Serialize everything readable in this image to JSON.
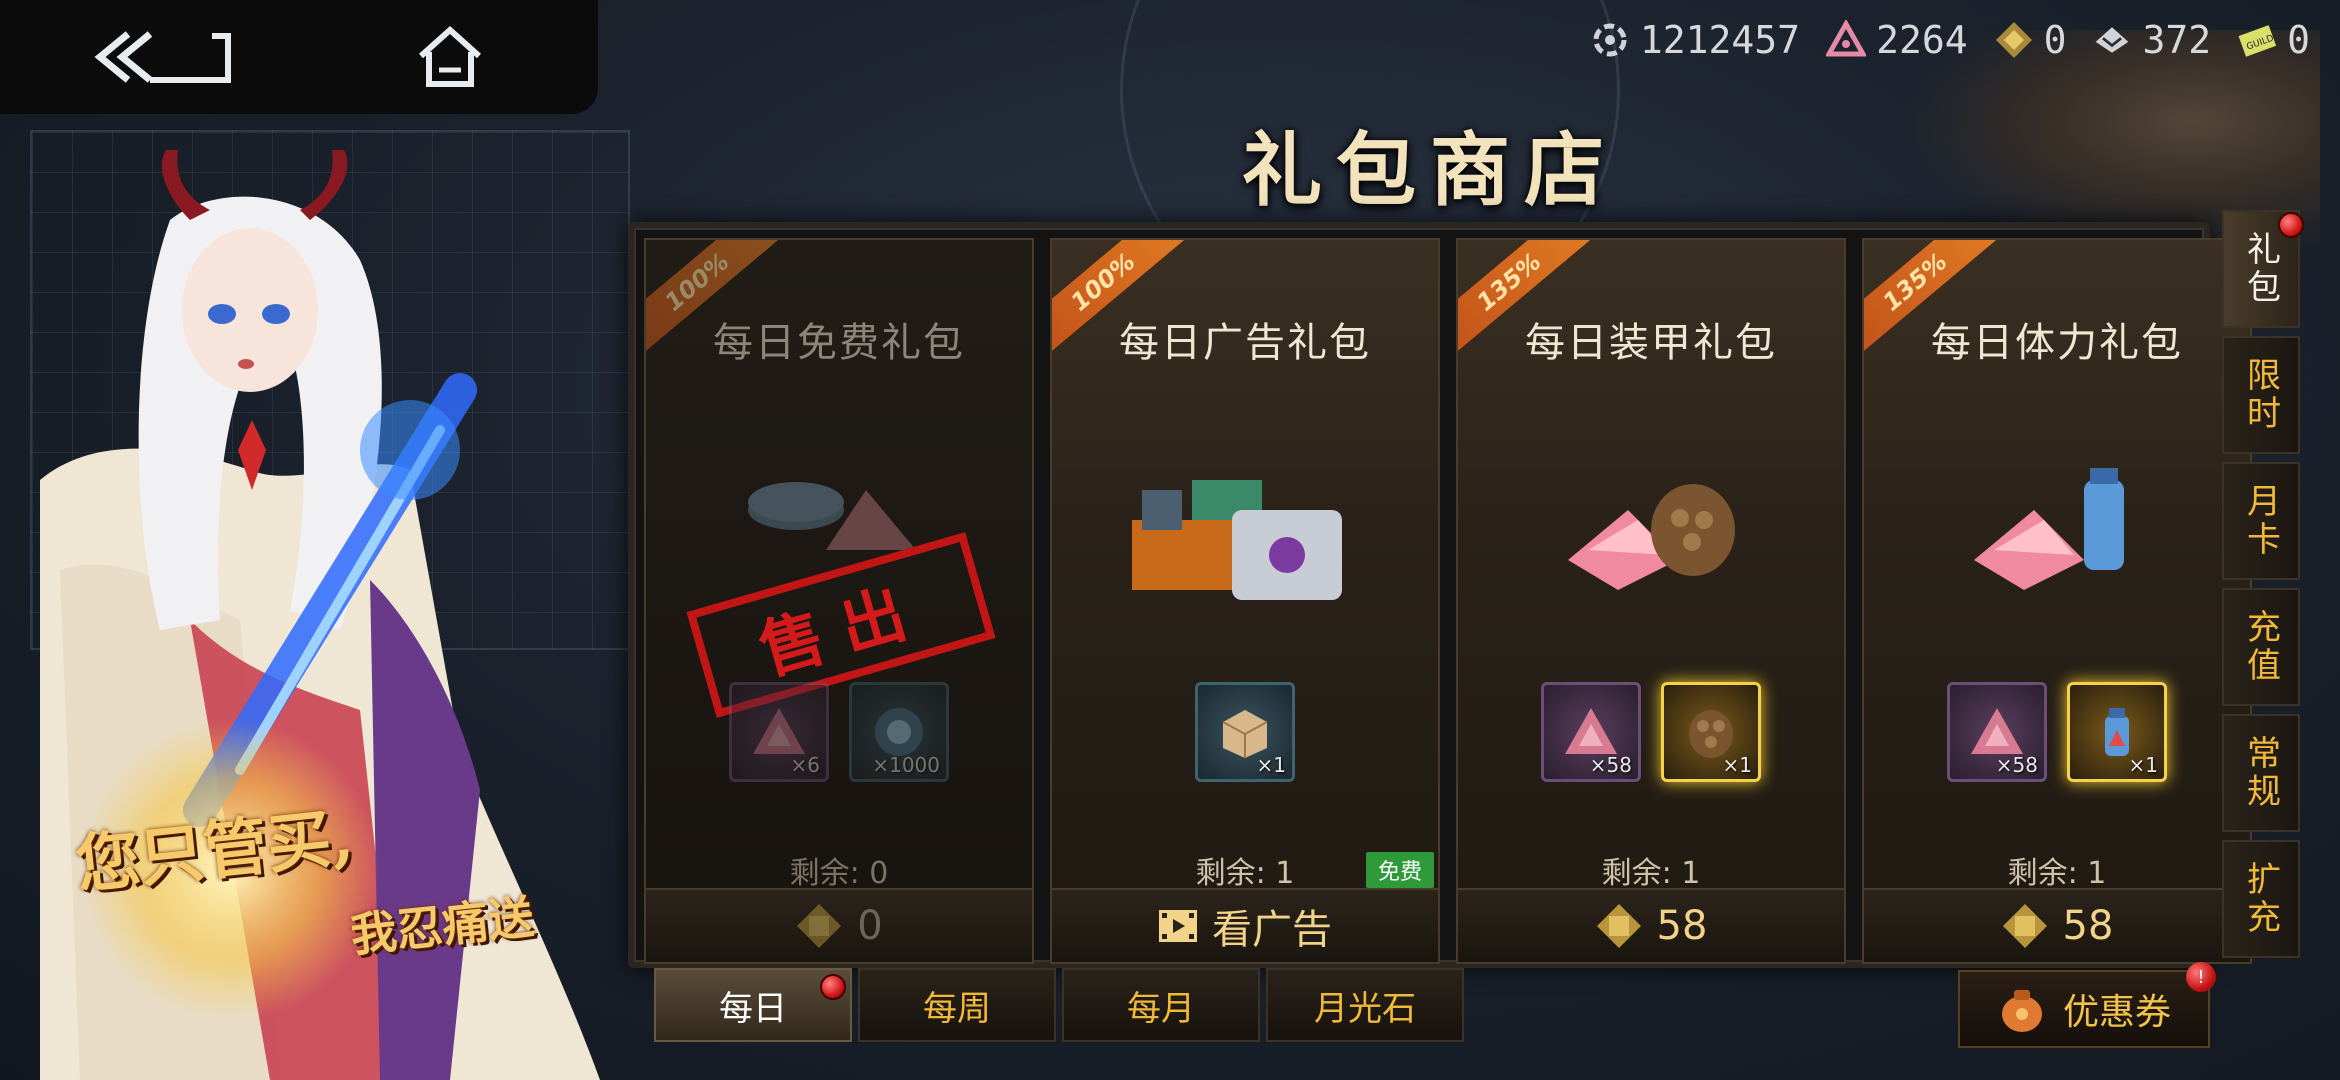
{
  "currencies": [
    {
      "icon": "gear-target-icon",
      "value": "1212457"
    },
    {
      "icon": "pink-crystal-icon",
      "value": "2264"
    },
    {
      "icon": "gold-chip-icon",
      "value": "0"
    },
    {
      "icon": "armor-plate-icon",
      "value": "372"
    },
    {
      "icon": "guild-icon",
      "value": "0",
      "badge": "GUILD"
    }
  ],
  "title": "礼包商店",
  "slogan": {
    "line1": "您只管买,",
    "line2": "我忍痛送"
  },
  "packs": [
    {
      "discount": "100%",
      "title": "每日免费礼包",
      "items": [
        {
          "icon": "pink-crystal-icon",
          "qty": "×6"
        },
        {
          "icon": "gear-coin-icon",
          "qty": "×1000"
        }
      ],
      "remaining": "剩余: 0",
      "price": "0",
      "sold_out": "售出"
    },
    {
      "discount": "100%",
      "title": "每日广告礼包",
      "items": [
        {
          "icon": "supply-box-icon",
          "qty": "×1"
        }
      ],
      "remaining": "剩余: 1",
      "action": "看广告",
      "free_badge": "免费"
    },
    {
      "discount": "135%",
      "title": "每日装甲礼包",
      "items": [
        {
          "icon": "pink-crystal-icon",
          "qty": "×58"
        },
        {
          "icon": "armor-scale-icon",
          "qty": "×1"
        }
      ],
      "remaining": "剩余: 1",
      "price": "58"
    },
    {
      "discount": "135%",
      "title": "每日体力礼包",
      "items": [
        {
          "icon": "pink-crystal-icon",
          "qty": "×58"
        },
        {
          "icon": "stamina-potion-icon",
          "qty": "×1"
        }
      ],
      "remaining": "剩余: 1",
      "price": "58"
    }
  ],
  "side_tabs": [
    "礼包",
    "限时",
    "月卡",
    "充值",
    "常规",
    "扩充"
  ],
  "bottom_tabs": [
    "每日",
    "每周",
    "每月",
    "月光石"
  ],
  "coupon": {
    "label": "优惠券",
    "badge": "!"
  },
  "colors": {
    "accent_gold": "#f1b93a",
    "ribbon": "#d9661e",
    "free_green": "#2f9a3a",
    "alert_red": "#d01818"
  }
}
